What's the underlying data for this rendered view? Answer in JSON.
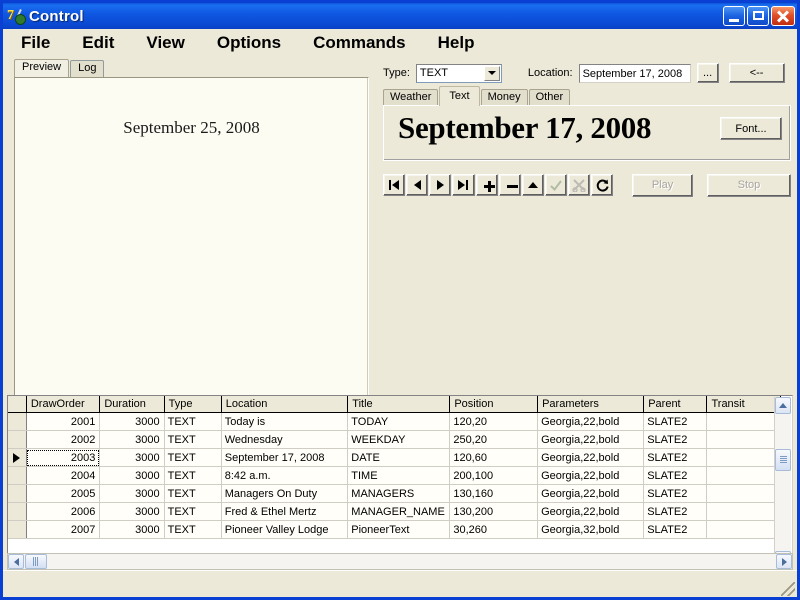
{
  "window": {
    "title": "Control",
    "app_icon": "seven-paintbrush-icon",
    "controls": {
      "minimize": "minimize-button",
      "maximize": "maximize-button",
      "close": "close-button"
    }
  },
  "menubar": {
    "items": [
      {
        "label": "File"
      },
      {
        "label": "Edit"
      },
      {
        "label": "View"
      },
      {
        "label": "Options"
      },
      {
        "label": "Commands"
      },
      {
        "label": "Help"
      }
    ]
  },
  "preview": {
    "tabs": [
      {
        "label": "Preview",
        "active": true
      },
      {
        "label": "Log",
        "active": false
      }
    ],
    "canvas_text": "September 25, 2008"
  },
  "editor": {
    "type_label": "Type:",
    "type_value": "TEXT",
    "location_label": "Location:",
    "location_value": "September 17, 2008",
    "browse_label": "...",
    "back_label": "<--",
    "category_tabs": [
      {
        "label": "Weather",
        "active": false
      },
      {
        "label": "Text",
        "active": true
      },
      {
        "label": "Money",
        "active": false
      },
      {
        "label": "Other",
        "active": false
      }
    ],
    "preview_value": "September 17, 2008",
    "font_button": "Font...",
    "toolbar": [
      {
        "name": "first-record-button",
        "glyph": "first",
        "disabled": false
      },
      {
        "name": "previous-record-button",
        "glyph": "prev",
        "disabled": false
      },
      {
        "name": "next-record-button",
        "glyph": "next",
        "disabled": false
      },
      {
        "name": "last-record-button",
        "glyph": "last",
        "disabled": false
      },
      {
        "name": "add-record-button",
        "glyph": "plus",
        "disabled": false
      },
      {
        "name": "delete-record-button",
        "glyph": "minus",
        "disabled": false
      },
      {
        "name": "edit-record-button",
        "glyph": "up",
        "disabled": false
      },
      {
        "name": "post-edit-button",
        "glyph": "check",
        "disabled": true
      },
      {
        "name": "cancel-edit-button",
        "glyph": "cancel",
        "disabled": true
      },
      {
        "name": "refresh-button",
        "glyph": "refresh",
        "disabled": false
      }
    ],
    "play_label": "Play",
    "play_disabled": true,
    "stop_label": "Stop",
    "stop_disabled": true
  },
  "grid": {
    "columns": [
      "DrawOrder",
      "Duration",
      "Type",
      "Location",
      "Title",
      "Position",
      "Parameters",
      "Parent",
      "Transit"
    ],
    "selected_row": 2,
    "selected_column": 0,
    "rows": [
      {
        "DrawOrder": "2001",
        "Duration": "3000",
        "Type": "TEXT",
        "Location": "Today is",
        "Title": "TODAY",
        "Position": "120,20",
        "Parameters": "Georgia,22,bold",
        "Parent": "SLATE2",
        "Transit": ""
      },
      {
        "DrawOrder": "2002",
        "Duration": "3000",
        "Type": "TEXT",
        "Location": "Wednesday",
        "Title": "WEEKDAY",
        "Position": "250,20",
        "Parameters": "Georgia,22,bold",
        "Parent": "SLATE2",
        "Transit": ""
      },
      {
        "DrawOrder": "2003",
        "Duration": "3000",
        "Type": "TEXT",
        "Location": "September 17, 2008",
        "Title": "DATE",
        "Position": "120,60",
        "Parameters": "Georgia,22,bold",
        "Parent": "SLATE2",
        "Transit": ""
      },
      {
        "DrawOrder": "2004",
        "Duration": "3000",
        "Type": "TEXT",
        "Location": "8:42 a.m.",
        "Title": "TIME",
        "Position": "200,100",
        "Parameters": "Georgia,22,bold",
        "Parent": "SLATE2",
        "Transit": ""
      },
      {
        "DrawOrder": "2005",
        "Duration": "3000",
        "Type": "TEXT",
        "Location": "Managers On Duty",
        "Title": "MANAGERS",
        "Position": "130,160",
        "Parameters": "Georgia,22,bold",
        "Parent": "SLATE2",
        "Transit": ""
      },
      {
        "DrawOrder": "2006",
        "Duration": "3000",
        "Type": "TEXT",
        "Location": "Fred & Ethel Mertz",
        "Title": "MANAGER_NAME",
        "Position": "130,200",
        "Parameters": "Georgia,22,bold",
        "Parent": "SLATE2",
        "Transit": ""
      },
      {
        "DrawOrder": "2007",
        "Duration": "3000",
        "Type": "TEXT",
        "Location": "Pioneer Valley Lodge",
        "Title": "PioneerText",
        "Position": "30,260",
        "Parameters": "Georgia,32,bold",
        "Parent": "SLATE2",
        "Transit": ""
      }
    ]
  },
  "statusbar": {
    "text": ""
  },
  "colors": {
    "titlebar": "#0f57e2",
    "face": "#ece9d8",
    "selection": "#2c5fc4",
    "grid_cell": "#fffef8",
    "preview_canvas": "#fdfcf2"
  }
}
